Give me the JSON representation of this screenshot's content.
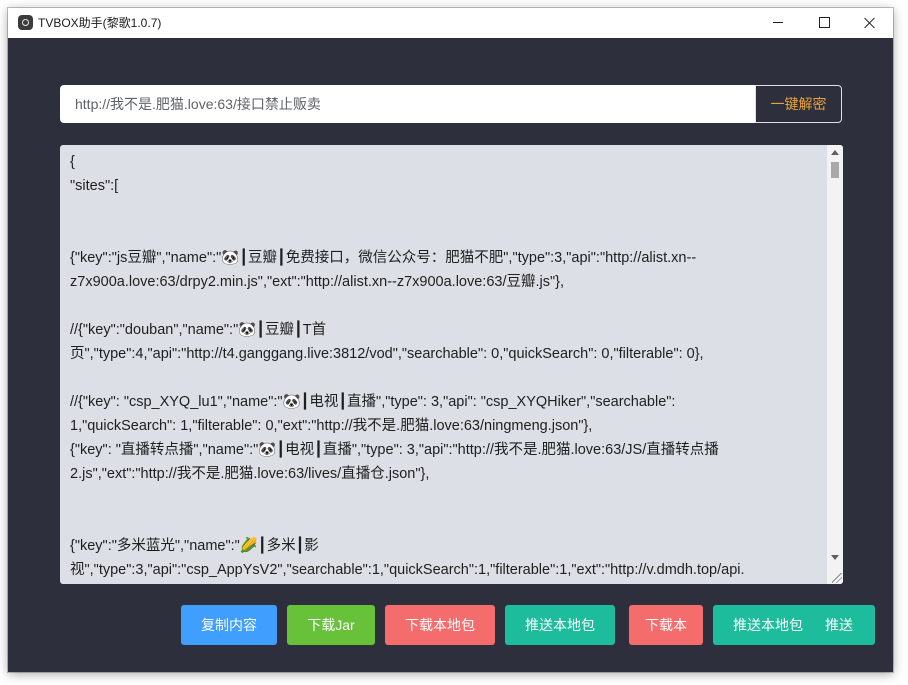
{
  "window": {
    "title": "TVBOX助手(黎歌1.0.7)",
    "icon": "app-logo-icon"
  },
  "window_controls": {
    "minimize_icon": "minimize-icon",
    "maximize_icon": "maximize-icon",
    "close_icon": "close-icon"
  },
  "url_input": {
    "value": "http://我不是.肥猫.love:63/接口禁止贩卖"
  },
  "decrypt_button": {
    "label": "一键解密"
  },
  "editor": {
    "lines": [
      "{",
      "\"sites\":[",
      "",
      "",
      "{\"key\":\"js豆瓣\",\"name\":\"🐼┃豆瓣┃免费接口，微信公众号：肥猫不肥\",\"type\":3,\"api\":\"http://alist.xn--",
      "z7x900a.love:63/drpy2.min.js\",\"ext\":\"http://alist.xn--z7x900a.love:63/豆瓣.js\"},",
      "",
      "//{\"key\":\"douban\",\"name\":\"🐼┃豆瓣┃T首",
      "页\",\"type\":4,\"api\":\"http://t4.ganggang.live:3812/vod\",\"searchable\": 0,\"quickSearch\": 0,\"filterable\": 0},",
      "",
      "//{\"key\": \"csp_XYQ_lu1\",\"name\":\"🐼┃电视┃直播\",\"type\": 3,\"api\": \"csp_XYQHiker\",\"searchable\":",
      "1,\"quickSearch\": 1,\"filterable\": 0,\"ext\":\"http://我不是.肥猫.love:63/ningmeng.json\"},",
      "{\"key\": \"直播转点播\",\"name\":\"🐼┃电视┃直播\",\"type\": 3,\"api\":\"http://我不是.肥猫.love:63/JS/直播转点播",
      "2.js\",\"ext\":\"http://我不是.肥猫.love:63/lives/直播仓.json\"},",
      "",
      "",
      "{\"key\":\"多米蓝光\",\"name\":\"🌽┃多米┃影",
      "视\",\"type\":3,\"api\":\"csp_AppYsV2\",\"searchable\":1,\"quickSearch\":1,\"filterable\":1,\"ext\":\"http://v.dmdh.top/api."
    ]
  },
  "actions": [
    {
      "label": "复制内容",
      "color": "#409eff"
    },
    {
      "label": "下载Jar",
      "color": "#67c23a"
    },
    {
      "label": "下载本地包",
      "color": "#f56c6c"
    },
    {
      "label": "推送本地包",
      "color": "#1cbc9c"
    },
    {
      "label": "下载本",
      "color": "#f56c6c"
    },
    {
      "label": "推送本地包",
      "color": "#1cbc9c"
    },
    {
      "label": "推送",
      "color": "#1cbc9c"
    }
  ],
  "colors": {
    "app_background": "#2d2f3d",
    "editor_background": "#dcdfe6",
    "decrypt_text": "#e6a23c",
    "input_text": "#606266"
  }
}
